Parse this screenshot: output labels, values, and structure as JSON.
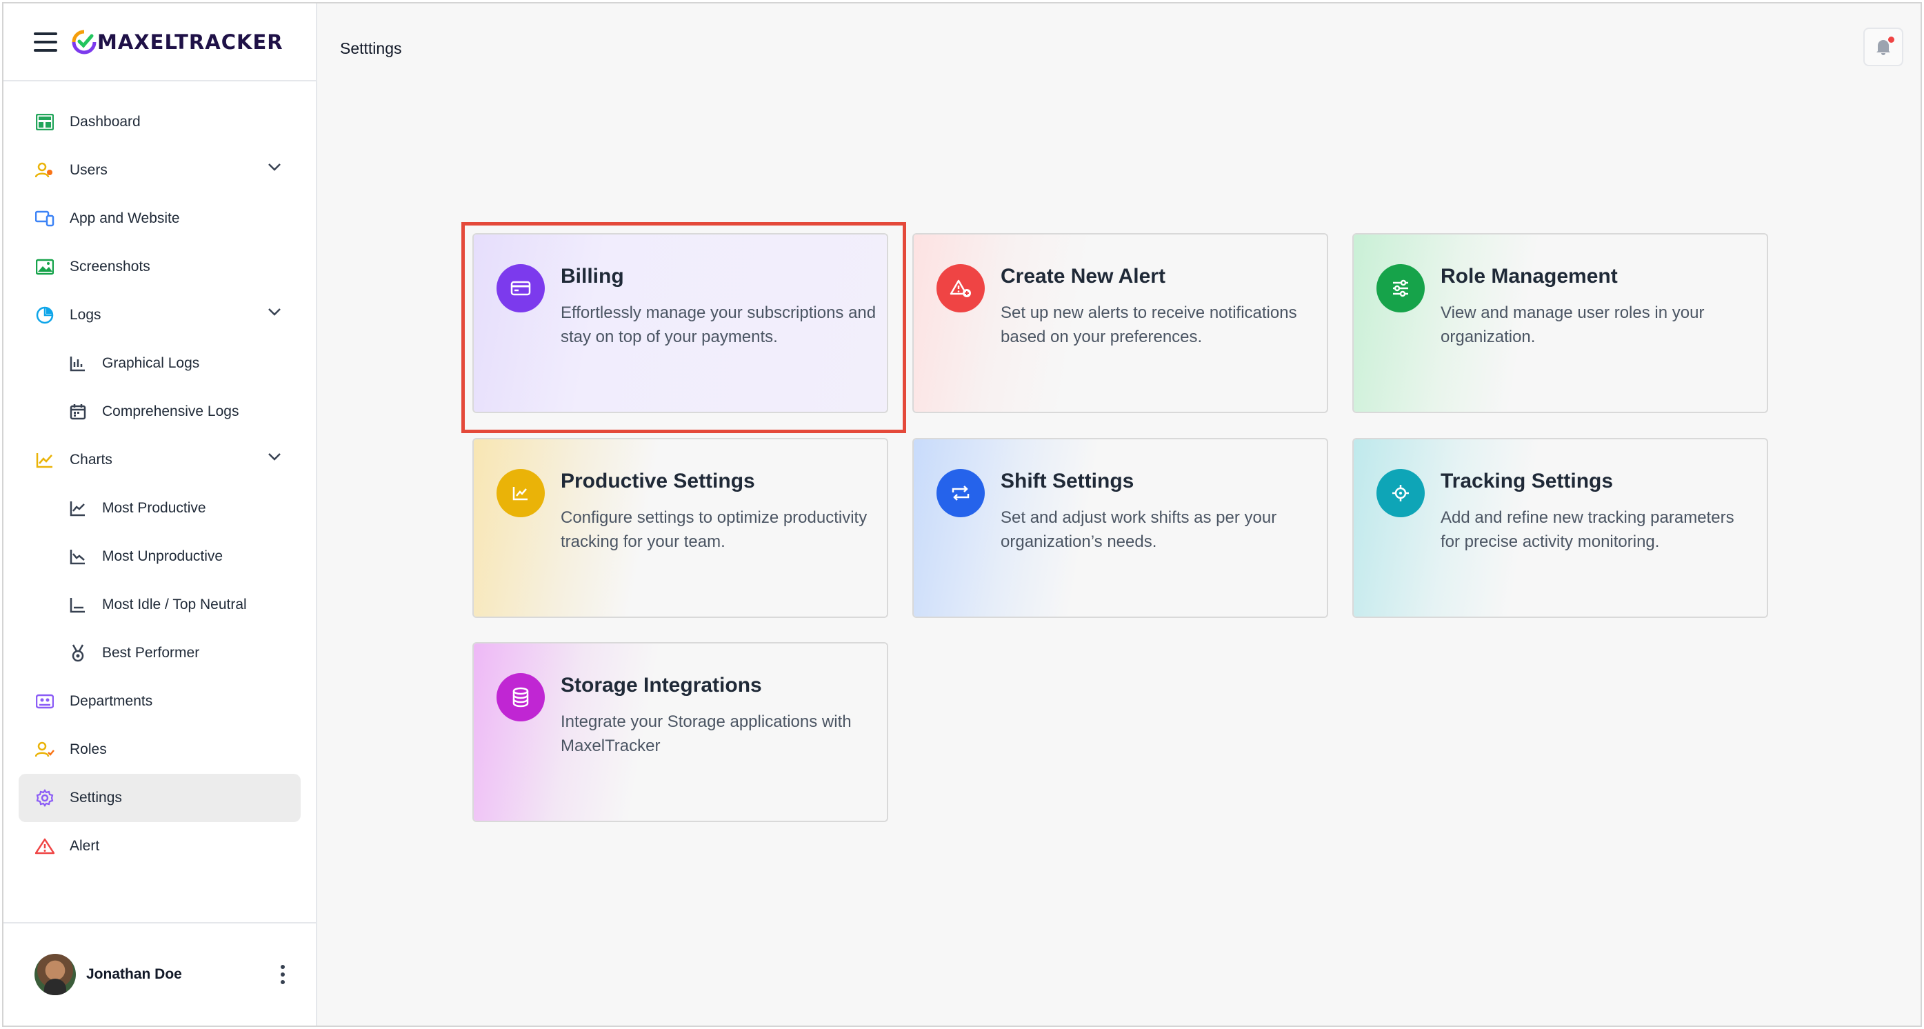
{
  "app": {
    "brand": "MAXELTRACKER",
    "page_title": "Setttings"
  },
  "sidebar": {
    "items": [
      {
        "label": "Dashboard",
        "icon": "dashboard-icon"
      },
      {
        "label": "Users",
        "icon": "users-icon",
        "expandable": true
      },
      {
        "label": "App and Website",
        "icon": "devices-icon"
      },
      {
        "label": "Screenshots",
        "icon": "image-icon"
      },
      {
        "label": "Logs",
        "icon": "pie-chart-icon",
        "expandable": true
      },
      {
        "label": "Graphical Logs",
        "icon": "bar-chart-icon",
        "sub": true
      },
      {
        "label": "Comprehensive Logs",
        "icon": "calendar-icon",
        "sub": true
      },
      {
        "label": "Charts",
        "icon": "line-chart-icon",
        "expandable": true
      },
      {
        "label": "Most Productive",
        "icon": "trend-up-icon",
        "sub": true
      },
      {
        "label": "Most Unproductive",
        "icon": "trend-down-icon",
        "sub": true
      },
      {
        "label": "Most Idle / Top Neutral",
        "icon": "axis-icon",
        "sub": true
      },
      {
        "label": "Best Performer",
        "icon": "medal-icon",
        "sub": true
      },
      {
        "label": "Departments",
        "icon": "departments-icon"
      },
      {
        "label": "Roles",
        "icon": "roles-icon"
      },
      {
        "label": "Settings",
        "icon": "gear-icon",
        "active": true
      },
      {
        "label": "Alert",
        "icon": "alert-icon"
      }
    ]
  },
  "user": {
    "name": "Jonathan Doe"
  },
  "cards": [
    {
      "title": "Billing",
      "description": "Effortlessly manage your subscriptions and stay on top of your payments.",
      "icon": "credit-card-icon",
      "color": "#7c3aed"
    },
    {
      "title": "Create New Alert",
      "description": "Set up new alerts to receive notifications based on your preferences.",
      "icon": "alert-add-icon",
      "color": "#ef4444"
    },
    {
      "title": "Role Management",
      "description": "View and manage user roles in your organization.",
      "icon": "sliders-icon",
      "color": "#16a34a"
    },
    {
      "title": "Productive Settings",
      "description": "Configure settings to optimize productivity tracking for your team.",
      "icon": "chart-line-icon",
      "color": "#eab308"
    },
    {
      "title": "Shift Settings",
      "description": "Set and adjust work shifts as per your organization’s needs.",
      "icon": "swap-icon",
      "color": "#2563eb"
    },
    {
      "title": "Tracking Settings",
      "description": "Add and refine new tracking parameters for precise activity monitoring.",
      "icon": "target-icon",
      "color": "#0ea5b7"
    },
    {
      "title": "Storage Integrations",
      "description": "Integrate your Storage applications with MaxelTracker",
      "icon": "database-icon",
      "color": "#c026d3"
    }
  ]
}
